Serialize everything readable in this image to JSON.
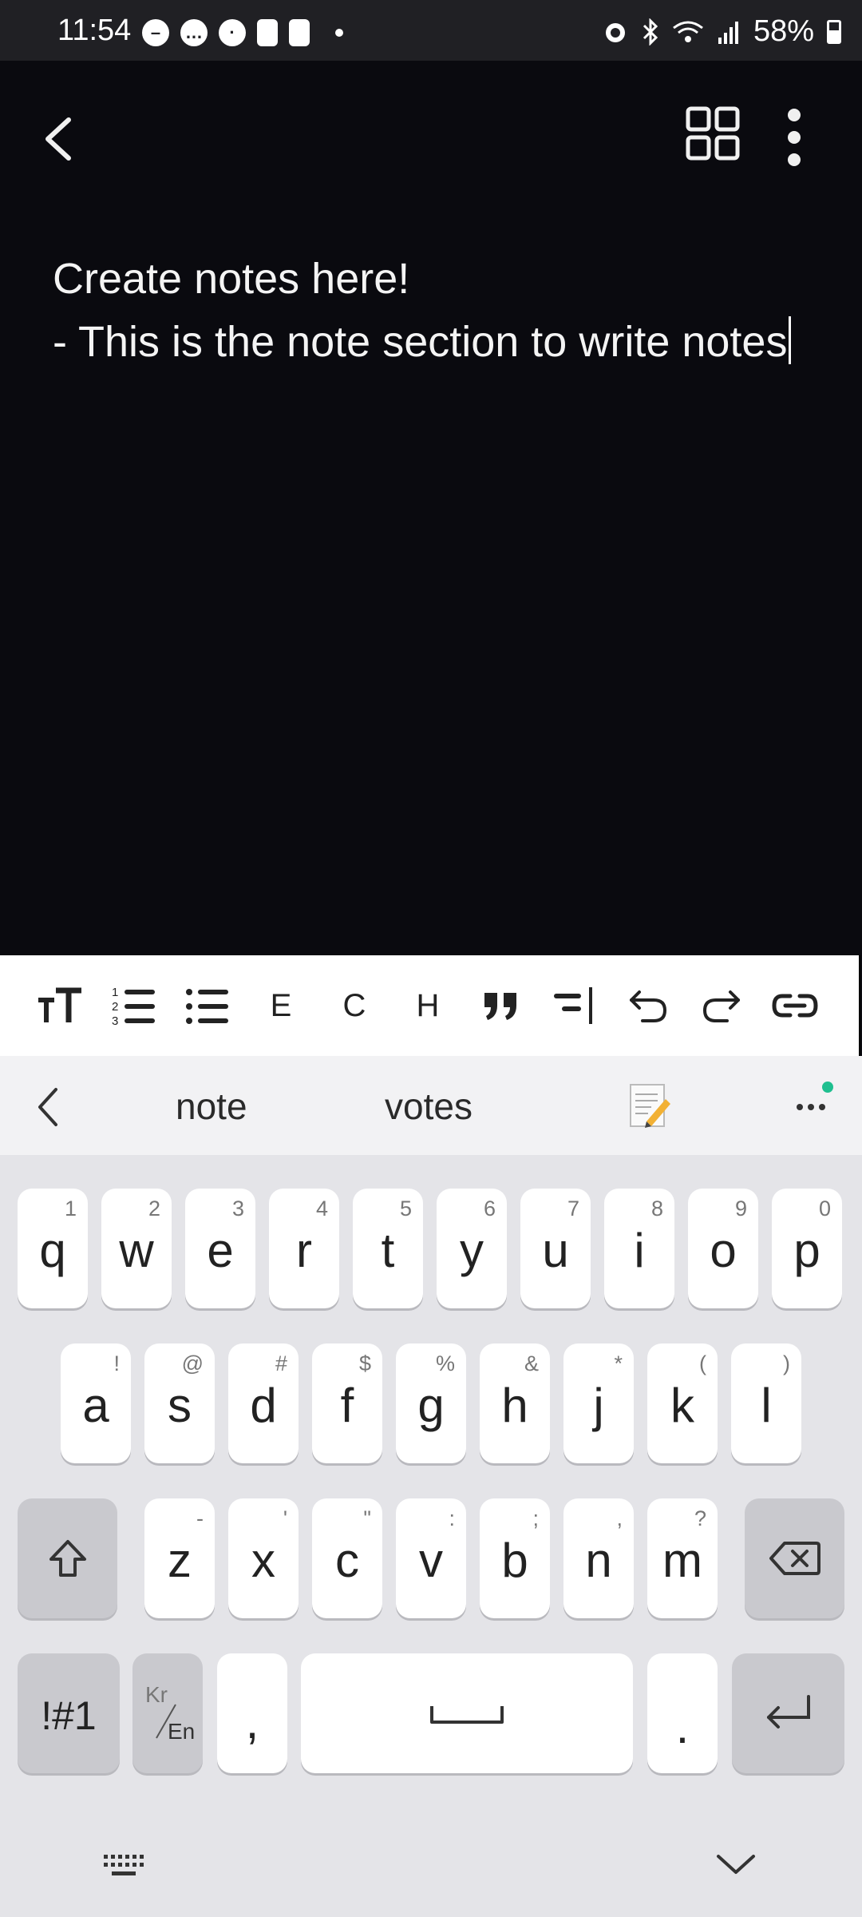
{
  "status_bar": {
    "time": "11:54",
    "battery": "58%",
    "notification_icons": [
      "do-not-disturb-icon",
      "chat-icon",
      "cat-icon",
      "cup-icon",
      "cup-icon",
      "dot-icon"
    ],
    "system_icons": [
      "alarm-icon",
      "bluetooth-icon",
      "wifi-icon",
      "signal-icon",
      "battery-icon"
    ]
  },
  "app_bar": {
    "back_icon": "chevron-left-icon",
    "grid_icon": "grid-view-icon",
    "more_icon": "more-vertical-icon"
  },
  "note": {
    "lines": [
      "Create notes here!",
      "- This is the note section to write notes"
    ]
  },
  "format_toolbar": {
    "items": [
      {
        "name": "text-size-icon"
      },
      {
        "name": "numbered-list-icon"
      },
      {
        "name": "bullet-list-icon"
      },
      {
        "name": "format-e",
        "label": "E"
      },
      {
        "name": "format-c",
        "label": "C"
      },
      {
        "name": "format-h",
        "label": "H"
      },
      {
        "name": "quote-icon"
      },
      {
        "name": "indent-icon"
      },
      {
        "name": "undo-icon"
      },
      {
        "name": "redo-icon"
      },
      {
        "name": "link-icon"
      }
    ]
  },
  "suggestions": {
    "words": [
      "note",
      "votes"
    ],
    "emoji_icon": "memo-icon",
    "more_icon": "more-horizontal-icon",
    "accent_color": "#1fbf8f"
  },
  "keyboard": {
    "row1": [
      {
        "main": "q",
        "alt": "1"
      },
      {
        "main": "w",
        "alt": "2"
      },
      {
        "main": "e",
        "alt": "3"
      },
      {
        "main": "r",
        "alt": "4"
      },
      {
        "main": "t",
        "alt": "5"
      },
      {
        "main": "y",
        "alt": "6"
      },
      {
        "main": "u",
        "alt": "7"
      },
      {
        "main": "i",
        "alt": "8"
      },
      {
        "main": "o",
        "alt": "9"
      },
      {
        "main": "p",
        "alt": "0"
      }
    ],
    "row2": [
      {
        "main": "a",
        "alt": "!"
      },
      {
        "main": "s",
        "alt": "@"
      },
      {
        "main": "d",
        "alt": "#"
      },
      {
        "main": "f",
        "alt": "$"
      },
      {
        "main": "g",
        "alt": "%"
      },
      {
        "main": "h",
        "alt": "&"
      },
      {
        "main": "j",
        "alt": "*"
      },
      {
        "main": "k",
        "alt": "("
      },
      {
        "main": "l",
        "alt": ")"
      }
    ],
    "row3": [
      {
        "main": "z",
        "alt": "-"
      },
      {
        "main": "x",
        "alt": "'"
      },
      {
        "main": "c",
        "alt": "\""
      },
      {
        "main": "v",
        "alt": ":"
      },
      {
        "main": "b",
        "alt": ";"
      },
      {
        "main": "n",
        "alt": ","
      },
      {
        "main": "m",
        "alt": "?"
      }
    ],
    "symbols_label": "!#1",
    "lang_top": "Kr",
    "lang_bottom": "En",
    "comma": ",",
    "period": ".",
    "shift_icon": "shift-icon",
    "backspace_icon": "backspace-icon",
    "enter_icon": "enter-icon",
    "keyboard_icon": "keyboard-icon",
    "hide_icon": "chevron-down-icon"
  },
  "colors": {
    "background": "#0a0a0f",
    "keyboard_bg": "#e4e4e8"
  }
}
